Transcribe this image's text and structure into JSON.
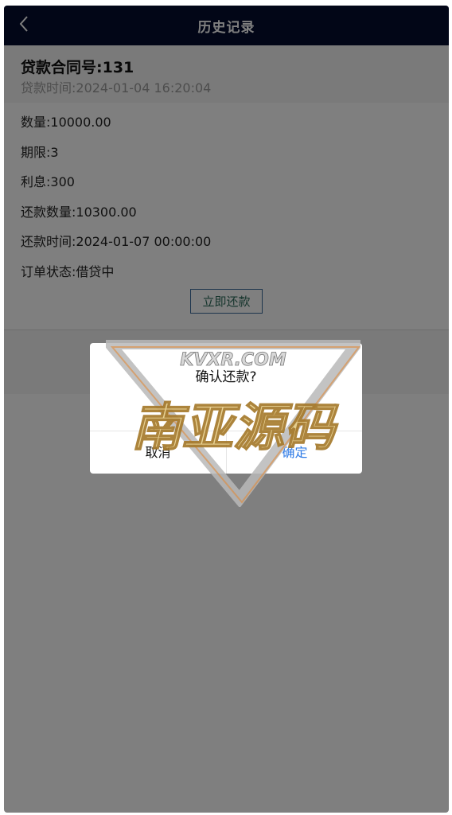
{
  "header": {
    "title": "历史记录",
    "back_icon": "chevron-left-icon"
  },
  "loan": {
    "contract_no": "贷款合同号:131",
    "loan_time": "贷款时间:2024-01-04 16:20:04",
    "details": [
      "数量:10000.00",
      "期限:3",
      "利息:300",
      "还款数量:10300.00",
      "还款时间:2024-01-07 00:00:00",
      "订单状态:借贷中"
    ],
    "repay_button": "立即还款"
  },
  "dialog": {
    "message": "确认还款?",
    "cancel_label": "取消",
    "confirm_label": "确定"
  },
  "watermark": {
    "top_text": "KVXR.COM",
    "main_text": "南亚源码"
  },
  "colors": {
    "header_bg": "#050d2e",
    "confirm_text": "#2f7be6",
    "overlay": "rgba(0,0,0,0.5)"
  }
}
